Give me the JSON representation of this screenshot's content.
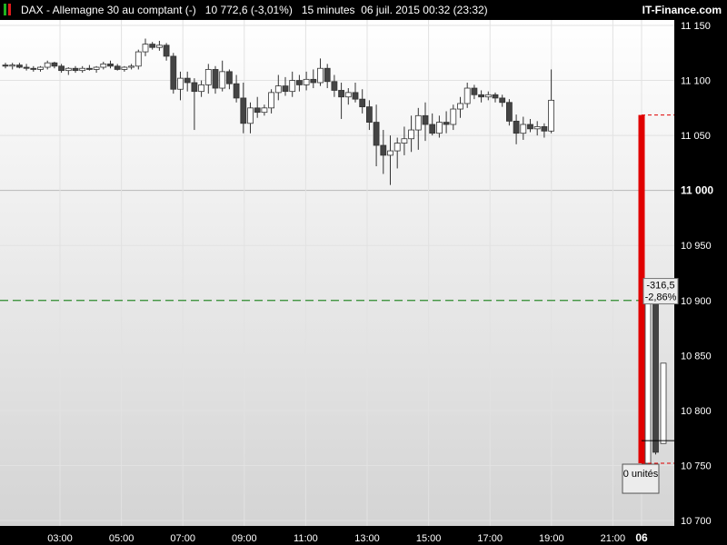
{
  "header": {
    "instrument": "DAX - Allemagne 30 au comptant (-)",
    "price_change": "10 772,6 (-3,01%)",
    "interval": "15 minutes",
    "datetime": "06 juil. 2015 00:32 (23:32)",
    "brand": "IT-Finance.com"
  },
  "colors": {
    "background_top": "#ffffff",
    "background_bottom": "#d4d4d4",
    "gap_bar": "#e00000",
    "dashed_line": "#2e8b2e",
    "bull_candle": "#ffffff",
    "bear_candle": "#444444"
  },
  "chart_data": {
    "type": "candlestick",
    "ylim": [
      10700,
      11150
    ],
    "y_ticks": [
      11150,
      11100,
      11050,
      11000,
      10950,
      10900,
      10850,
      10800,
      10750,
      10700
    ],
    "y_tick_labels": [
      "11 150",
      "11 100",
      "11 050",
      "11 000",
      "10 950",
      "10 900",
      "10 850",
      "10 800",
      "10 750",
      "10 700"
    ],
    "x_ticks": [
      "03:00",
      "05:00",
      "07:00",
      "09:00",
      "11:00",
      "13:00",
      "15:00",
      "17:00",
      "19:00",
      "21:00",
      "06"
    ],
    "reference_line": 10900,
    "gap": {
      "from": 11068.6,
      "to": 10752,
      "change": "-316,5",
      "change_pct": "-2,86%"
    },
    "current_price": 10772.6,
    "position_label": "0 unités",
    "candles": [
      [
        11114,
        11116,
        11111,
        11113
      ],
      [
        11113,
        11116,
        11110,
        11114
      ],
      [
        11114,
        11116,
        11111,
        11112
      ],
      [
        11112,
        11115,
        11109,
        11111
      ],
      [
        11111,
        11113,
        11108,
        11110
      ],
      [
        11110,
        11113,
        11108,
        11112
      ],
      [
        11112,
        11118,
        11110,
        11116
      ],
      [
        11116,
        11117,
        11111,
        11113
      ],
      [
        11113,
        11115,
        11107,
        11109
      ],
      [
        11109,
        11112,
        11105,
        11111
      ],
      [
        11111,
        11113,
        11107,
        11109
      ],
      [
        11109,
        11113,
        11107,
        11111
      ],
      [
        11111,
        11114,
        11109,
        11110
      ],
      [
        11110,
        11113,
        11107,
        11112
      ],
      [
        11112,
        11117,
        11110,
        11115
      ],
      [
        11115,
        11118,
        11111,
        11113
      ],
      [
        11113,
        11115,
        11109,
        11110
      ],
      [
        11110,
        11113,
        11108,
        11112
      ],
      [
        11112,
        11115,
        11110,
        11113
      ],
      [
        11113,
        11128,
        11110,
        11126
      ],
      [
        11126,
        11138,
        11122,
        11133
      ],
      [
        11133,
        11135,
        11128,
        11130
      ],
      [
        11130,
        11136,
        11127,
        11132
      ],
      [
        11132,
        11134,
        11118,
        11122
      ],
      [
        11122,
        11125,
        11088,
        11092
      ],
      [
        11092,
        11108,
        11082,
        11102
      ],
      [
        11102,
        11108,
        11090,
        11098
      ],
      [
        11098,
        11102,
        11055,
        11090
      ],
      [
        11090,
        11100,
        11085,
        11096
      ],
      [
        11096,
        11115,
        11088,
        11110
      ],
      [
        11110,
        11113,
        11088,
        11093
      ],
      [
        11093,
        11118,
        11090,
        11108
      ],
      [
        11108,
        11110,
        11092,
        11097
      ],
      [
        11097,
        11105,
        11080,
        11084
      ],
      [
        11084,
        11098,
        11052,
        11061
      ],
      [
        11061,
        11080,
        11052,
        11075
      ],
      [
        11075,
        11085,
        11066,
        11071
      ],
      [
        11071,
        11078,
        11068,
        11075
      ],
      [
        11075,
        11092,
        11070,
        11089
      ],
      [
        11089,
        11105,
        11082,
        11095
      ],
      [
        11095,
        11103,
        11086,
        11090
      ],
      [
        11090,
        11108,
        11085,
        11100
      ],
      [
        11100,
        11105,
        11090,
        11096
      ],
      [
        11096,
        11108,
        11091,
        11101
      ],
      [
        11101,
        11110,
        11093,
        11098
      ],
      [
        11098,
        11120,
        11095,
        11111
      ],
      [
        11111,
        11115,
        11093,
        11099
      ],
      [
        11099,
        11105,
        11085,
        11091
      ],
      [
        11091,
        11098,
        11065,
        11085
      ],
      [
        11085,
        11093,
        11078,
        11089
      ],
      [
        11089,
        11098,
        11080,
        11083
      ],
      [
        11083,
        11092,
        11070,
        11076
      ],
      [
        11076,
        11082,
        11055,
        11062
      ],
      [
        11062,
        11078,
        11022,
        11041
      ],
      [
        11041,
        11055,
        11015,
        11032
      ],
      [
        11032,
        11050,
        11005,
        11036
      ],
      [
        11036,
        11048,
        11020,
        11043
      ],
      [
        11043,
        11058,
        11032,
        11047
      ],
      [
        11047,
        11068,
        11035,
        11055
      ],
      [
        11055,
        11075,
        11037,
        11068
      ],
      [
        11068,
        11080,
        11045,
        11060
      ],
      [
        11060,
        11070,
        11050,
        11052
      ],
      [
        11052,
        11068,
        11048,
        11062
      ],
      [
        11062,
        11072,
        11052,
        11060
      ],
      [
        11060,
        11078,
        11055,
        11074
      ],
      [
        11074,
        11085,
        11066,
        11079
      ],
      [
        11079,
        11098,
        11075,
        11093
      ],
      [
        11093,
        11096,
        11083,
        11087
      ],
      [
        11087,
        11091,
        11080,
        11085
      ],
      [
        11085,
        11090,
        11082,
        11087
      ],
      [
        11087,
        11089,
        11080,
        11084
      ],
      [
        11084,
        11087,
        11076,
        11080
      ],
      [
        11080,
        11083,
        11059,
        11063
      ],
      [
        11063,
        11069,
        11042,
        11052
      ],
      [
        11052,
        11067,
        11046,
        11060
      ],
      [
        11060,
        11065,
        11053,
        11056
      ],
      [
        11056,
        11063,
        11050,
        11058
      ],
      [
        11058,
        11061,
        11048,
        11054
      ],
      [
        11054,
        11110,
        11052,
        11082
      ],
      [
        10752,
        10900,
        10752,
        10900
      ],
      [
        10900,
        10910,
        10760,
        10762
      ],
      [
        10770,
        10842,
        10770,
        10843
      ]
    ]
  }
}
